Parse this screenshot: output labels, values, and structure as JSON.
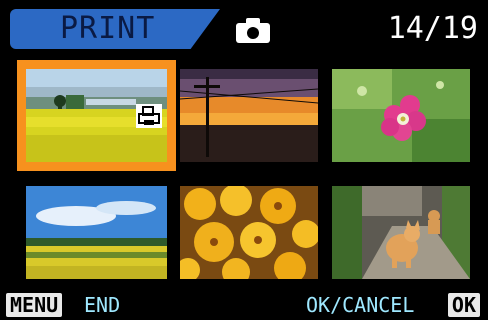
{
  "header": {
    "mode_label": "PRINT",
    "mode_icon": "camera-icon",
    "counter": "14/19",
    "accent_color": "#2c69c4"
  },
  "grid": {
    "selected_index": 0,
    "selected_color": "#f7911e",
    "thumbnails": [
      {
        "subject": "yellow-field-landscape",
        "print_marked": true
      },
      {
        "subject": "sunset-power-pole"
      },
      {
        "subject": "pink-flower"
      },
      {
        "subject": "sky-and-sunflower-field"
      },
      {
        "subject": "yellow-flowers-closeup"
      },
      {
        "subject": "cat-on-path"
      }
    ]
  },
  "footer": {
    "menu_button": "MENU",
    "menu_action": "END",
    "okcancel_label": "OK/CANCEL",
    "ok_button": "OK"
  }
}
